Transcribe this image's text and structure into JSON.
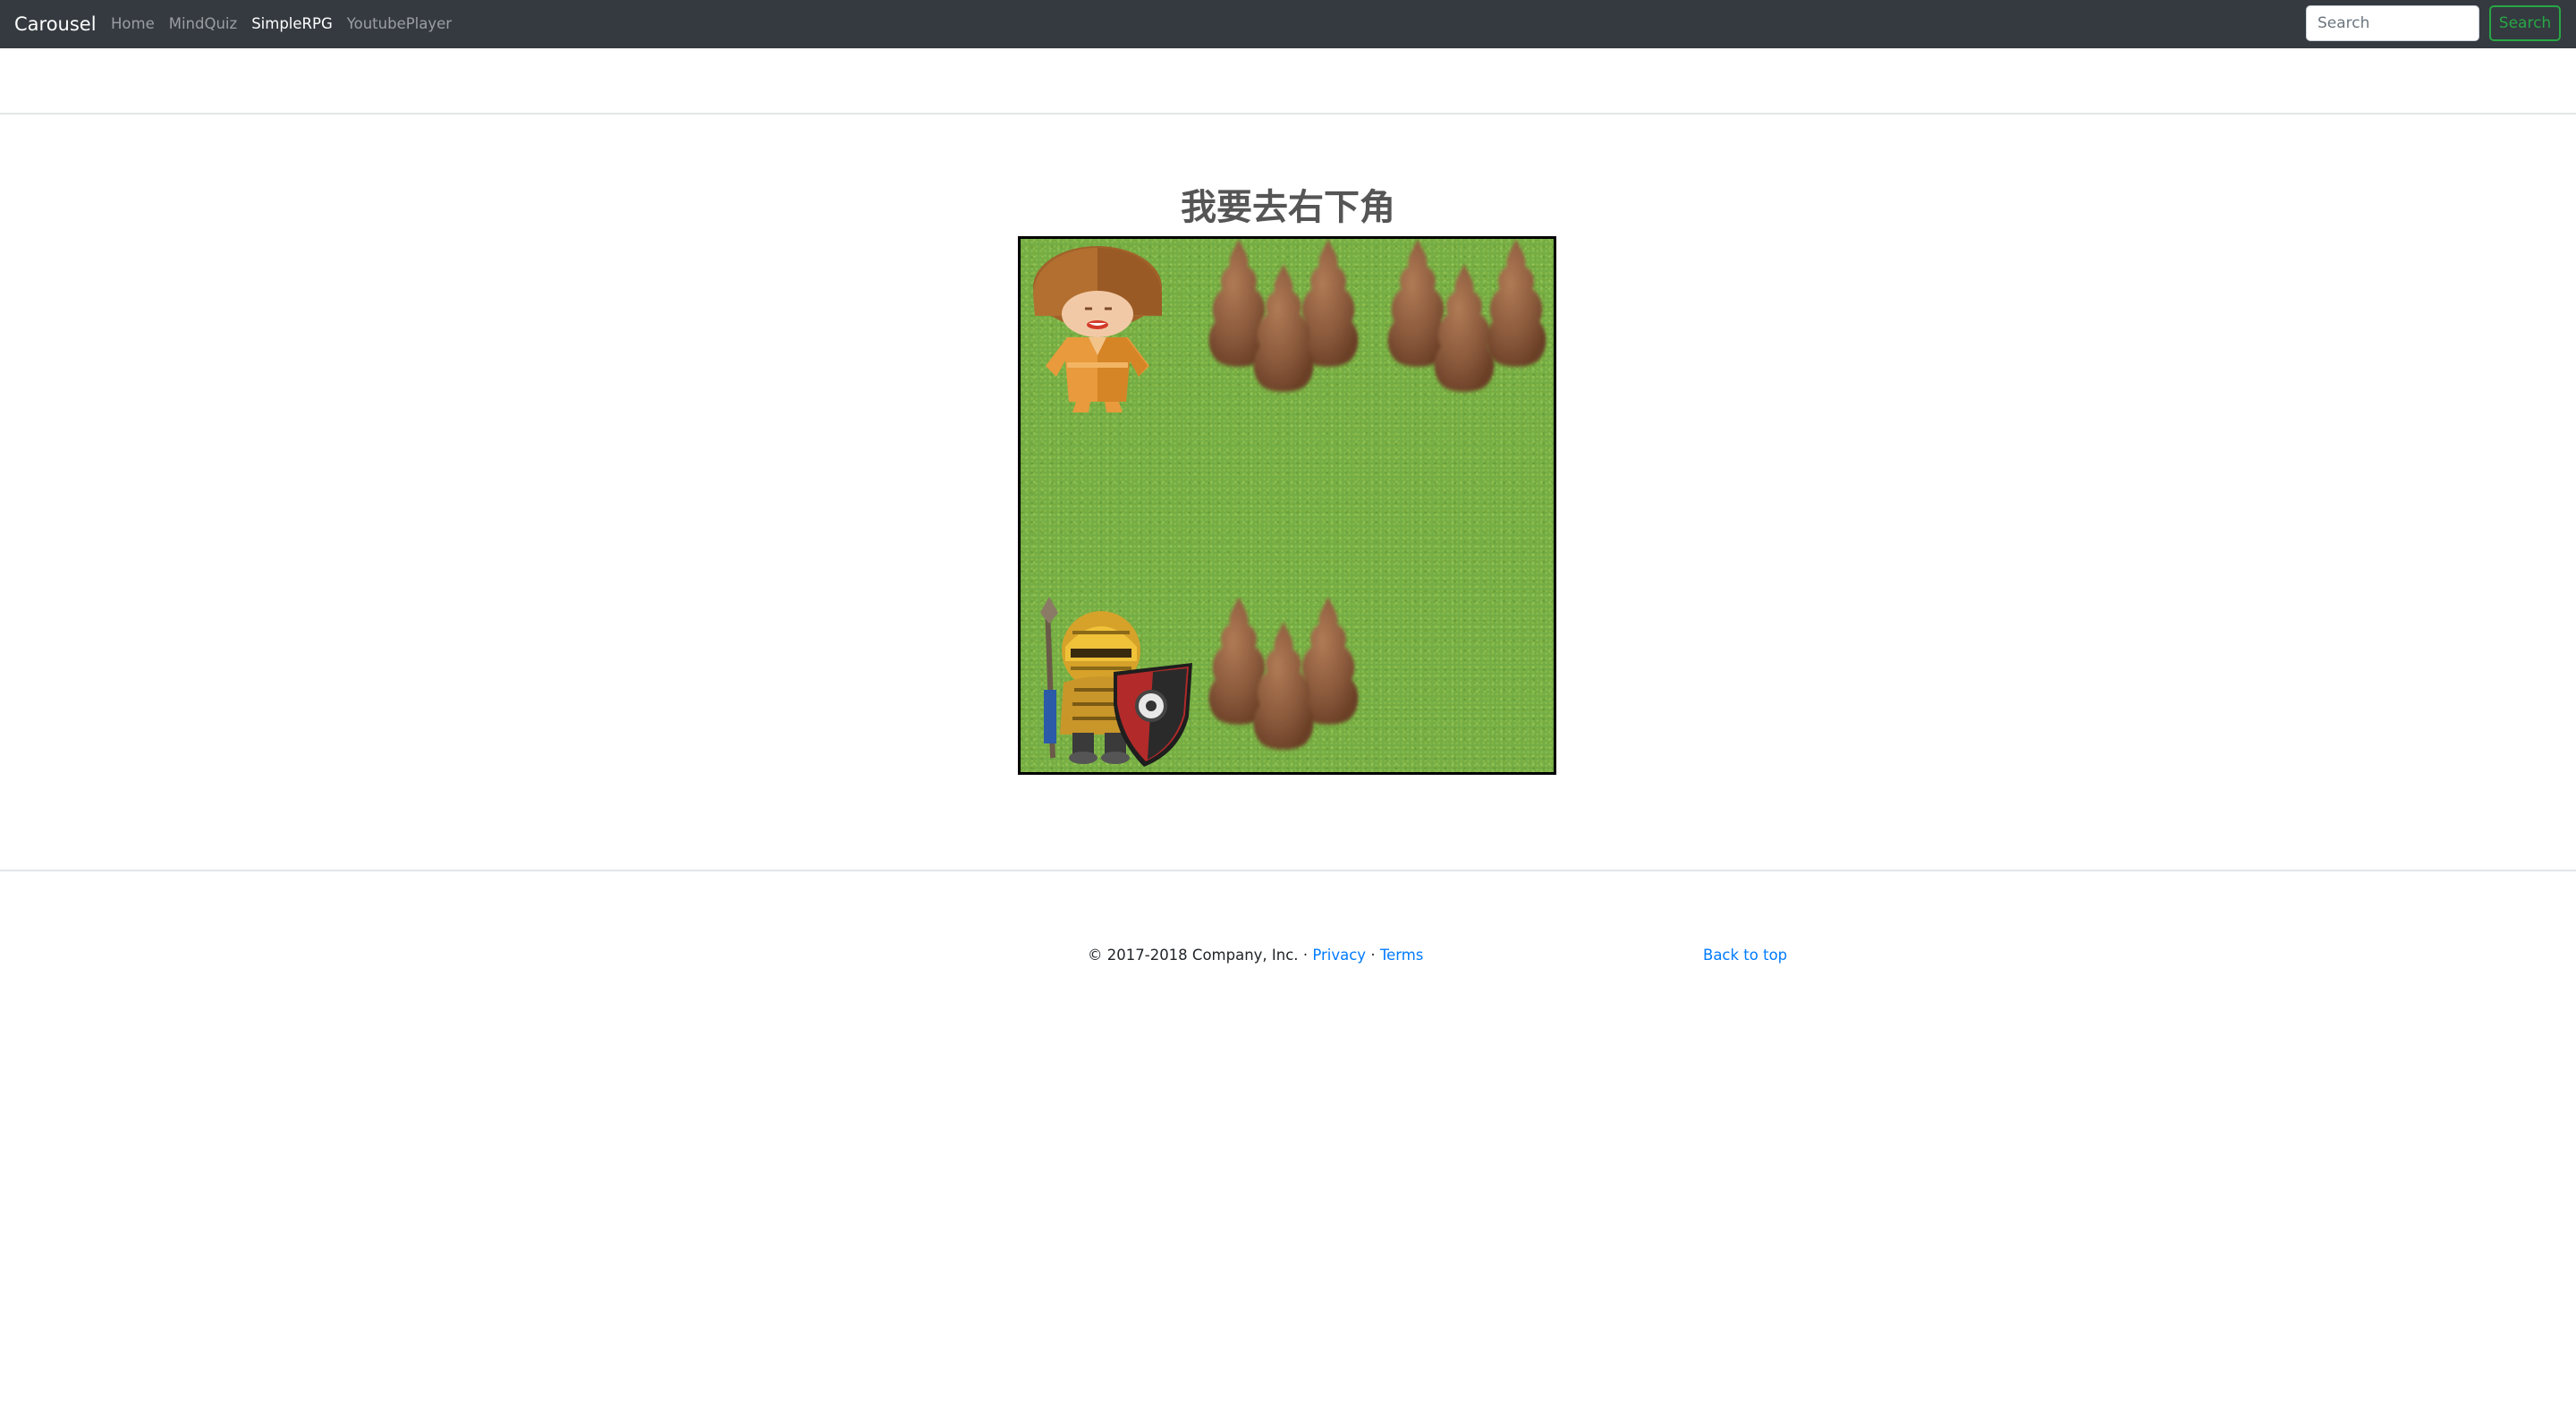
{
  "navbar": {
    "brand": "Carousel",
    "links": [
      {
        "label": "Home",
        "active": false
      },
      {
        "label": "MindQuiz",
        "active": false
      },
      {
        "label": "SimpleRPG",
        "active": true
      },
      {
        "label": "YoutubePlayer",
        "active": false
      }
    ],
    "search_placeholder": "Search",
    "search_button": "Search"
  },
  "game": {
    "title": "我要去右下角",
    "grid": {
      "rows": 3,
      "cols": 3
    },
    "tiles": [
      {
        "row": 0,
        "col": 0,
        "content": "villager-girl"
      },
      {
        "row": 0,
        "col": 1,
        "content": "trees"
      },
      {
        "row": 0,
        "col": 2,
        "content": "trees"
      },
      {
        "row": 1,
        "col": 0,
        "content": "grass"
      },
      {
        "row": 1,
        "col": 1,
        "content": "grass"
      },
      {
        "row": 1,
        "col": 2,
        "content": "grass"
      },
      {
        "row": 2,
        "col": 0,
        "content": "armored-knight"
      },
      {
        "row": 2,
        "col": 1,
        "content": "trees"
      },
      {
        "row": 2,
        "col": 2,
        "content": "grass"
      }
    ]
  },
  "footer": {
    "copyright": "© 2017-2018 Company, Inc.",
    "separator": "·",
    "privacy": "Privacy",
    "terms": "Terms",
    "back_to_top": "Back to top"
  },
  "colors": {
    "navbar_bg": "#343a40",
    "link": "#007bff",
    "search_button": "#28a745",
    "grass": "#74ad45",
    "tree": "#8b5a3c"
  }
}
